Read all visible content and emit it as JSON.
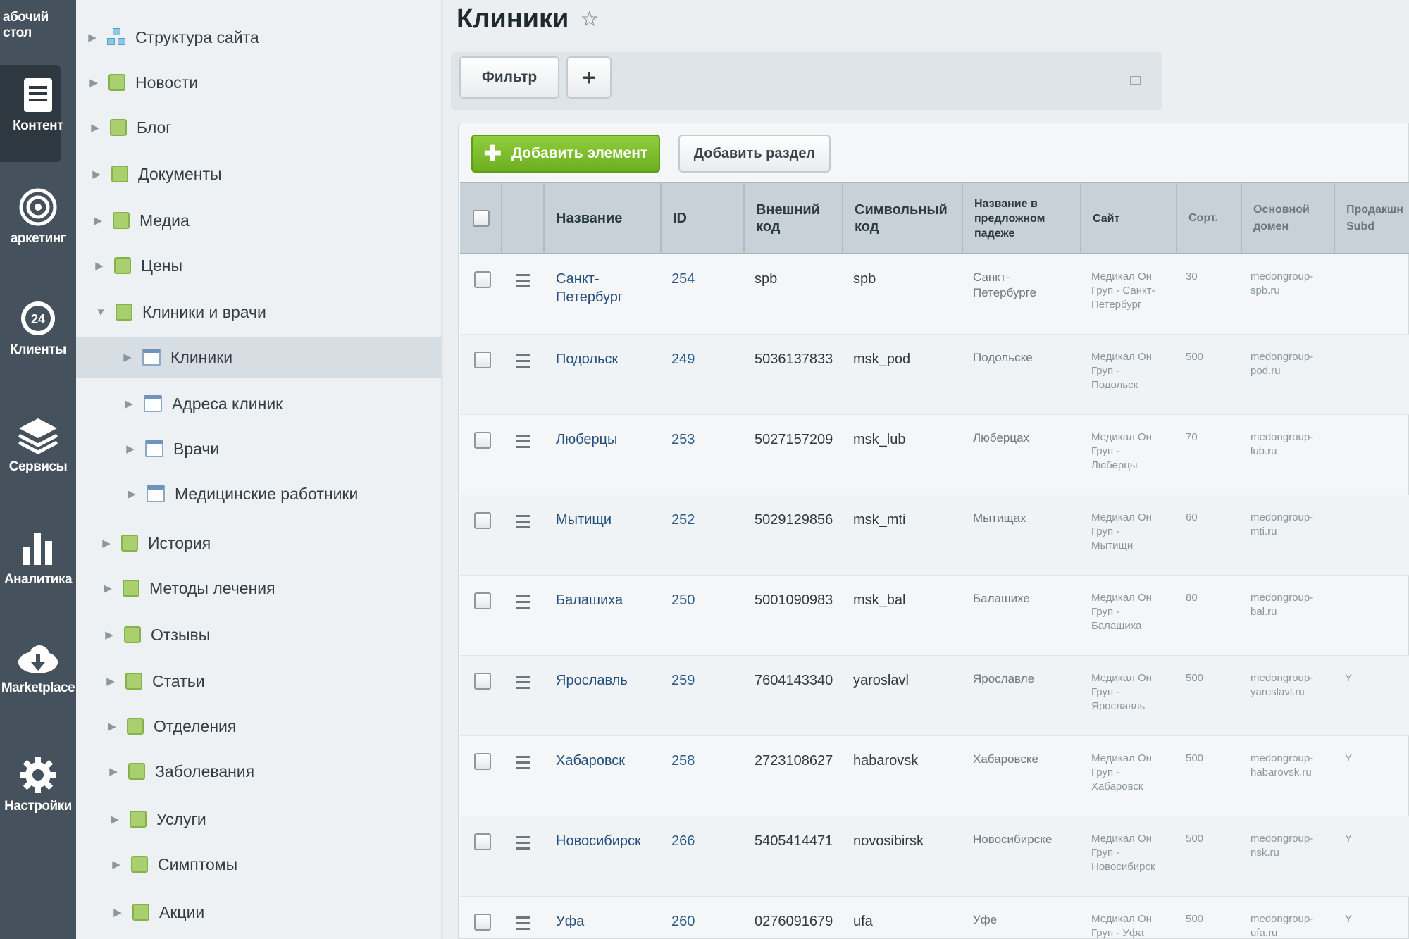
{
  "left_menu": {
    "items": [
      {
        "key": "desktop",
        "label_line1": "абочий",
        "label_line2": "стол",
        "icon": "desktop-icon"
      },
      {
        "key": "content",
        "label": "Контент",
        "icon": "document-icon",
        "active": true
      },
      {
        "key": "marketing",
        "label": "аркетинг",
        "icon": "target-icon"
      },
      {
        "key": "clients",
        "label": "Клиенты",
        "icon": "24h-icon"
      },
      {
        "key": "services",
        "label": "Сервисы",
        "icon": "layers-icon"
      },
      {
        "key": "analytics",
        "label": "Аналитика",
        "icon": "bar-chart-icon"
      },
      {
        "key": "marketplace",
        "label": "Marketplace",
        "icon": "cloud-download-icon"
      },
      {
        "key": "settings",
        "label": "Настройки",
        "icon": "gear-icon"
      }
    ]
  },
  "tree": {
    "items": [
      {
        "label": "Структура сайта",
        "icon": "site-structure-icon",
        "level": 0,
        "expanded": false
      },
      {
        "label": "Новости",
        "icon": "folder-icon",
        "level": 0
      },
      {
        "label": "Блог",
        "icon": "folder-icon",
        "level": 0
      },
      {
        "label": "Документы",
        "icon": "folder-icon",
        "level": 0
      },
      {
        "label": "Медиа",
        "icon": "folder-icon",
        "level": 0
      },
      {
        "label": "Цены",
        "icon": "folder-icon",
        "level": 0
      },
      {
        "label": "Клиники и врачи",
        "icon": "folder-icon",
        "level": 0,
        "expanded": true
      },
      {
        "label": "Клиники",
        "icon": "list-page-icon",
        "level": 1,
        "selected": true
      },
      {
        "label": "Адреса клиник",
        "icon": "list-page-icon",
        "level": 1
      },
      {
        "label": "Врачи",
        "icon": "list-page-icon",
        "level": 1
      },
      {
        "label": "Медицинские работники",
        "icon": "list-page-icon",
        "level": 1
      },
      {
        "label": "История",
        "icon": "folder-icon",
        "level": 0
      },
      {
        "label": "Методы лечения",
        "icon": "folder-icon",
        "level": 0
      },
      {
        "label": "Отзывы",
        "icon": "folder-icon",
        "level": 0
      },
      {
        "label": "Статьи",
        "icon": "folder-icon",
        "level": 0
      },
      {
        "label": "Отделения",
        "icon": "folder-icon",
        "level": 0
      },
      {
        "label": "Заболевания",
        "icon": "folder-icon",
        "level": 0
      },
      {
        "label": "Услуги",
        "icon": "folder-icon",
        "level": 0
      },
      {
        "label": "Симптомы",
        "icon": "folder-icon",
        "level": 0
      },
      {
        "label": "Акции",
        "icon": "folder-icon",
        "level": 0
      }
    ]
  },
  "header": {
    "title": "Клиники",
    "favorite_icon": "star-icon"
  },
  "filter": {
    "filter_label": "Фильтр",
    "plus_label": "+"
  },
  "toolbar": {
    "add_element_label": "Добавить элемент",
    "add_section_label": "Добавить раздел",
    "accent": "#7ab92c"
  },
  "table": {
    "columns": [
      {
        "key": "name",
        "label": "Название"
      },
      {
        "key": "id",
        "label": "ID"
      },
      {
        "key": "ext",
        "label_line1": "Внешний",
        "label_line2": "код"
      },
      {
        "key": "code",
        "label_line1": "Символьный",
        "label_line2": "код"
      },
      {
        "key": "prep",
        "label_line1": "Название в",
        "label_line2": "предложном",
        "label_line3": "падеже"
      },
      {
        "key": "site",
        "label": "Сайт"
      },
      {
        "key": "sort",
        "label": "Сорт."
      },
      {
        "key": "domain",
        "label_line1": "Основной",
        "label_line2": "домен"
      },
      {
        "key": "prod",
        "label_line1": "Продакшн",
        "label_line2": "Subd"
      }
    ],
    "rows": [
      {
        "name1": "Санкт-",
        "name2": "Петербург",
        "id": "254",
        "ext": "spb",
        "code": "spb",
        "prep1": "Санкт-",
        "prep2": "Петербурге",
        "site1": "Медикал Он",
        "site2": "Груп - Санкт-",
        "site3": "Петербург",
        "sort": "30",
        "dom1": "medongroup-",
        "dom2": "spb.ru",
        "prod": ""
      },
      {
        "name1": "Подольск",
        "name2": "",
        "id": "249",
        "ext": "5036137833",
        "code": "msk_pod",
        "prep1": "Подольске",
        "prep2": "",
        "site1": "Медикал Он",
        "site2": "Груп -",
        "site3": "Подольск",
        "sort": "500",
        "dom1": "medongroup-",
        "dom2": "pod.ru",
        "prod": ""
      },
      {
        "name1": "Люберцы",
        "name2": "",
        "id": "253",
        "ext": "5027157209",
        "code": "msk_lub",
        "prep1": "Люберцах",
        "prep2": "",
        "site1": "Медикал Он",
        "site2": "Груп -",
        "site3": "Люберцы",
        "sort": "70",
        "dom1": "medongroup-",
        "dom2": "lub.ru",
        "prod": ""
      },
      {
        "name1": "Мытищи",
        "name2": "",
        "id": "252",
        "ext": "5029129856",
        "code": "msk_mti",
        "prep1": "Мытищах",
        "prep2": "",
        "site1": "Медикал Он",
        "site2": "Груп -",
        "site3": "Мытищи",
        "sort": "60",
        "dom1": "medongroup-",
        "dom2": "mti.ru",
        "prod": ""
      },
      {
        "name1": "Балашиха",
        "name2": "",
        "id": "250",
        "ext": "5001090983",
        "code": "msk_bal",
        "prep1": "Балашихе",
        "prep2": "",
        "site1": "Медикал Он",
        "site2": "Груп -",
        "site3": "Балашиха",
        "sort": "80",
        "dom1": "medongroup-",
        "dom2": "bal.ru",
        "prod": ""
      },
      {
        "name1": "Ярославль",
        "name2": "",
        "id": "259",
        "ext": "7604143340",
        "code": "yaroslavl",
        "prep1": "Ярославле",
        "prep2": "",
        "site1": "Медикал Он",
        "site2": "Груп -",
        "site3": "Ярославль",
        "sort": "500",
        "dom1": "medongroup-",
        "dom2": "yaroslavl.ru",
        "prod": "Y"
      },
      {
        "name1": "Хабаровск",
        "name2": "",
        "id": "258",
        "ext": "2723108627",
        "code": "habarovsk",
        "prep1": "Хабаровске",
        "prep2": "",
        "site1": "Медикал Он",
        "site2": "Груп -",
        "site3": "Хабаровск",
        "sort": "500",
        "dom1": "medongroup-",
        "dom2": "habarovsk.ru",
        "prod": "Y"
      },
      {
        "name1": "Новосибирск",
        "name2": "",
        "id": "266",
        "ext": "5405414471",
        "code": "novosibirsk",
        "prep1": "Новосибирске",
        "prep2": "",
        "site1": "Медикал Он",
        "site2": "Груп -",
        "site3": "Новосибирск",
        "sort": "500",
        "dom1": "medongroup-",
        "dom2": "nsk.ru",
        "prod": "Y"
      },
      {
        "name1": "Уфа",
        "name2": "",
        "id": "260",
        "ext": "0276091679",
        "code": "ufa",
        "prep1": "Уфе",
        "prep2": "",
        "site1": "Медикал Он",
        "site2": "Груп - Уфа",
        "site3": "",
        "sort": "500",
        "dom1": "medongroup-",
        "dom2": "ufa.ru",
        "prod": "Y"
      }
    ]
  }
}
